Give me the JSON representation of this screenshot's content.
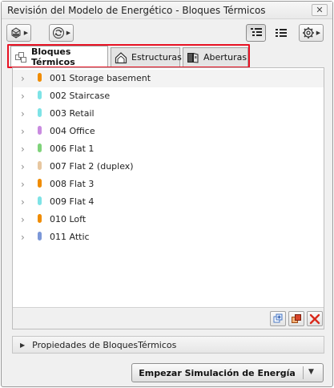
{
  "window": {
    "title": "Revisión del Modelo de Energético - Bloques Térmicos",
    "close_glyph": "✕"
  },
  "toolbar": {
    "left_buttons": [
      "model-view-icon",
      "refresh-icon"
    ],
    "right_buttons": [
      "list-detail-view-icon",
      "list-view-icon",
      "settings-gear-icon"
    ],
    "dropdown_glyph": "▶"
  },
  "tabs": [
    {
      "label": "Bloques Térmicos",
      "icon": "thermal-blocks-icon",
      "active": true
    },
    {
      "label": "Estructuras",
      "icon": "structure-house-icon",
      "active": false
    },
    {
      "label": "Aberturas",
      "icon": "openings-door-icon",
      "active": false
    }
  ],
  "accent_color": "#e81123",
  "list": {
    "expand_glyph": "›",
    "items": [
      {
        "label": "001 Storage basement",
        "color": "#f08c00"
      },
      {
        "label": "002 Staircase",
        "color": "#7ee3e6"
      },
      {
        "label": "003 Retail",
        "color": "#7ee3e6"
      },
      {
        "label": "004 Office",
        "color": "#c98be0"
      },
      {
        "label": "006 Flat 1",
        "color": "#7fd37a"
      },
      {
        "label": "007 Flat 2 (duplex)",
        "color": "#e7c7a0"
      },
      {
        "label": "008 Flat 3",
        "color": "#f08c00"
      },
      {
        "label": "009 Flat 4",
        "color": "#7ee3e6"
      },
      {
        "label": "010 Loft",
        "color": "#f08c00"
      },
      {
        "label": "011 Attic",
        "color": "#7c98d8"
      }
    ],
    "footer_buttons": [
      "add-block-icon",
      "duplicate-block-icon",
      "delete-icon"
    ]
  },
  "properties": {
    "label": "Propiedades de BloquesTérmicos",
    "expand_glyph": "▶"
  },
  "simulation": {
    "label": "Empezar Simulación de Energía",
    "dropdown_glyph": "▼"
  }
}
